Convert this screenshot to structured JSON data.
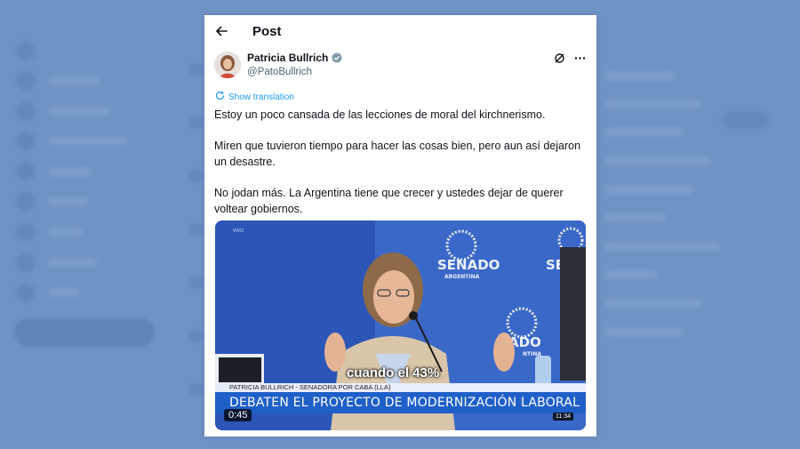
{
  "header": {
    "title": "Post"
  },
  "author": {
    "name": "Patricia Bullrich",
    "handle": "@PatoBullrich"
  },
  "show_translation_label": "Show translation",
  "tweet": {
    "paragraphs": [
      "Estoy un poco cansada de las lecciones de moral del kirchnerismo.",
      "Miren que tuvieron tiempo para hacer las cosas bien, pero aun así dejaron un desastre.",
      "No jodan más. La Argentina tiene que crecer y ustedes dejar de querer voltear gobiernos."
    ]
  },
  "media": {
    "live_label": "VIVO",
    "caption": "cuando el 43%",
    "name_strip": "PATRICIA BULLRICH - SENADORA POR CABA (LLA)",
    "headline": "DEBATEN EL PROYECTO DE MODERNIZACIÓN LABORAL",
    "elapsed": "0:45",
    "clock": "11:34",
    "backdrop_text": "SENADO",
    "backdrop_sub": "ARGENTINA"
  },
  "colors": {
    "page_bg": "#6f93c4",
    "accent": "#1d9bf0",
    "video_bg": "#2b56b8",
    "headline_bar": "#1f5fc8"
  },
  "icons": [
    "back-arrow-icon",
    "verified-badge-icon",
    "grok-icon",
    "more-icon",
    "translate-icon"
  ]
}
